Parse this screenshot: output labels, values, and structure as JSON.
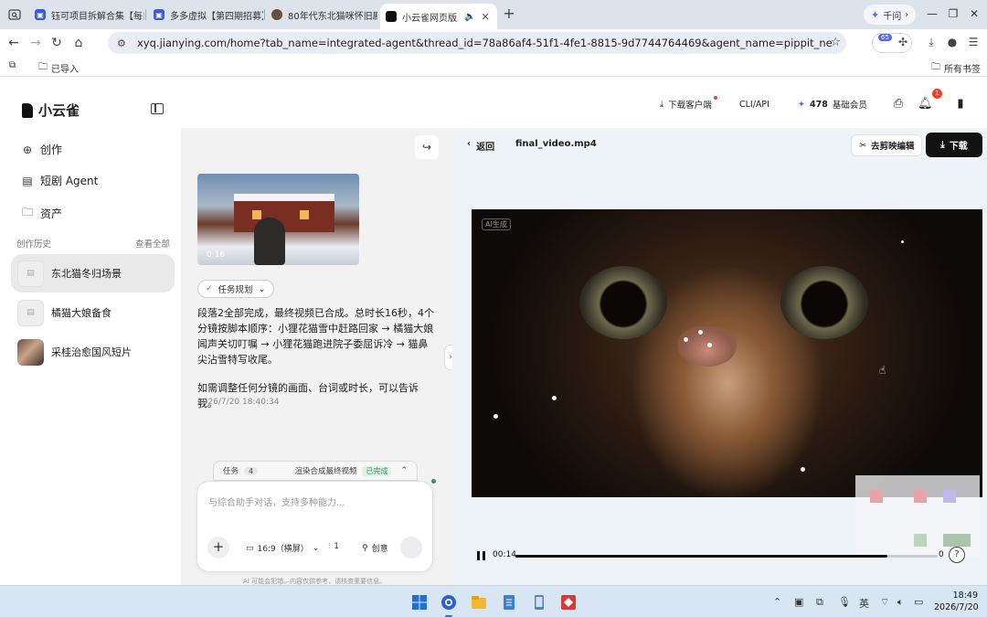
{
  "browser": {
    "tabs": [
      {
        "title": "钰可项目拆解合集【每日",
        "color": "#3b5bdb"
      },
      {
        "title": "多多虚拟【第四期招募】",
        "color": "#3b5bdb"
      },
      {
        "title": "80年代东北猫咪怀旧剧",
        "color": "#6b4e3d"
      },
      {
        "title": "小云雀网页版",
        "color": "#111111"
      }
    ],
    "new_tab": "+",
    "qianwen": "千问",
    "url": "xyq.jianying.com/home?tab_name=integrated-agent&thread_id=78a86af4-51f1-4fe1-8815-9d7744764469&agent_name=pippit_nest_agent&source=...",
    "ext_badge": "65",
    "bookmarks": {
      "imported": "已导入",
      "all": "所有书签"
    }
  },
  "app": {
    "logo": "小云雀",
    "nav": [
      {
        "label": "创作",
        "icon": "plus-circle-icon"
      },
      {
        "label": "短剧 Agent",
        "icon": "film-icon"
      },
      {
        "label": "资产",
        "icon": "folder-icon"
      }
    ],
    "history": {
      "title": "创作历史",
      "view_all": "查看全部",
      "items": [
        {
          "label": "东北猫冬归场景"
        },
        {
          "label": "橘猫大娘备食"
        },
        {
          "label": "采桂治愈国风短片"
        }
      ]
    },
    "header": {
      "download_client": "下载客户端",
      "cli_api": "CLI/API",
      "credits": "478",
      "membership": "基础会员",
      "notif_count": "1"
    }
  },
  "chat": {
    "video_duration": "0:16",
    "task_chip": "任务规划",
    "message": "段落2全部完成，最终视频已合成。总时长16秒，4个分镜按脚本顺序：小狸花猫雪中赶路回家 → 橘猫大娘闻声关切叮嘱 → 小狸花猫跑进院子委屈诉冷 → 猫鼻尖沾雪特写收尾。",
    "message2": "如需调整任何分镜的画面、台词或时长，可以告诉我。",
    "timestamp": "2026/7/20 18:40:34",
    "task_bar": {
      "label": "任务",
      "count": "4",
      "status": "渲染合成最终视频",
      "done": "已完成"
    },
    "composer": {
      "placeholder": "与综合助手对话，支持多种能力...",
      "ratio": "16:9（横屏）",
      "count": "1",
      "creative": "创意"
    },
    "disclaimer": "AI 可能会犯错，内容仅供参考，请核查重要信息。"
  },
  "player": {
    "back": "返回",
    "file_name": "final_video.mp4",
    "jianying": "去剪映编辑",
    "download": "下载",
    "ai_mark": "AI生成",
    "current_time": "00:14",
    "end_time_visible": "0",
    "progress": 0.88,
    "help": "?"
  },
  "taskbar": {
    "time": "18:49",
    "date": "2026/7/20",
    "ime": "英"
  }
}
